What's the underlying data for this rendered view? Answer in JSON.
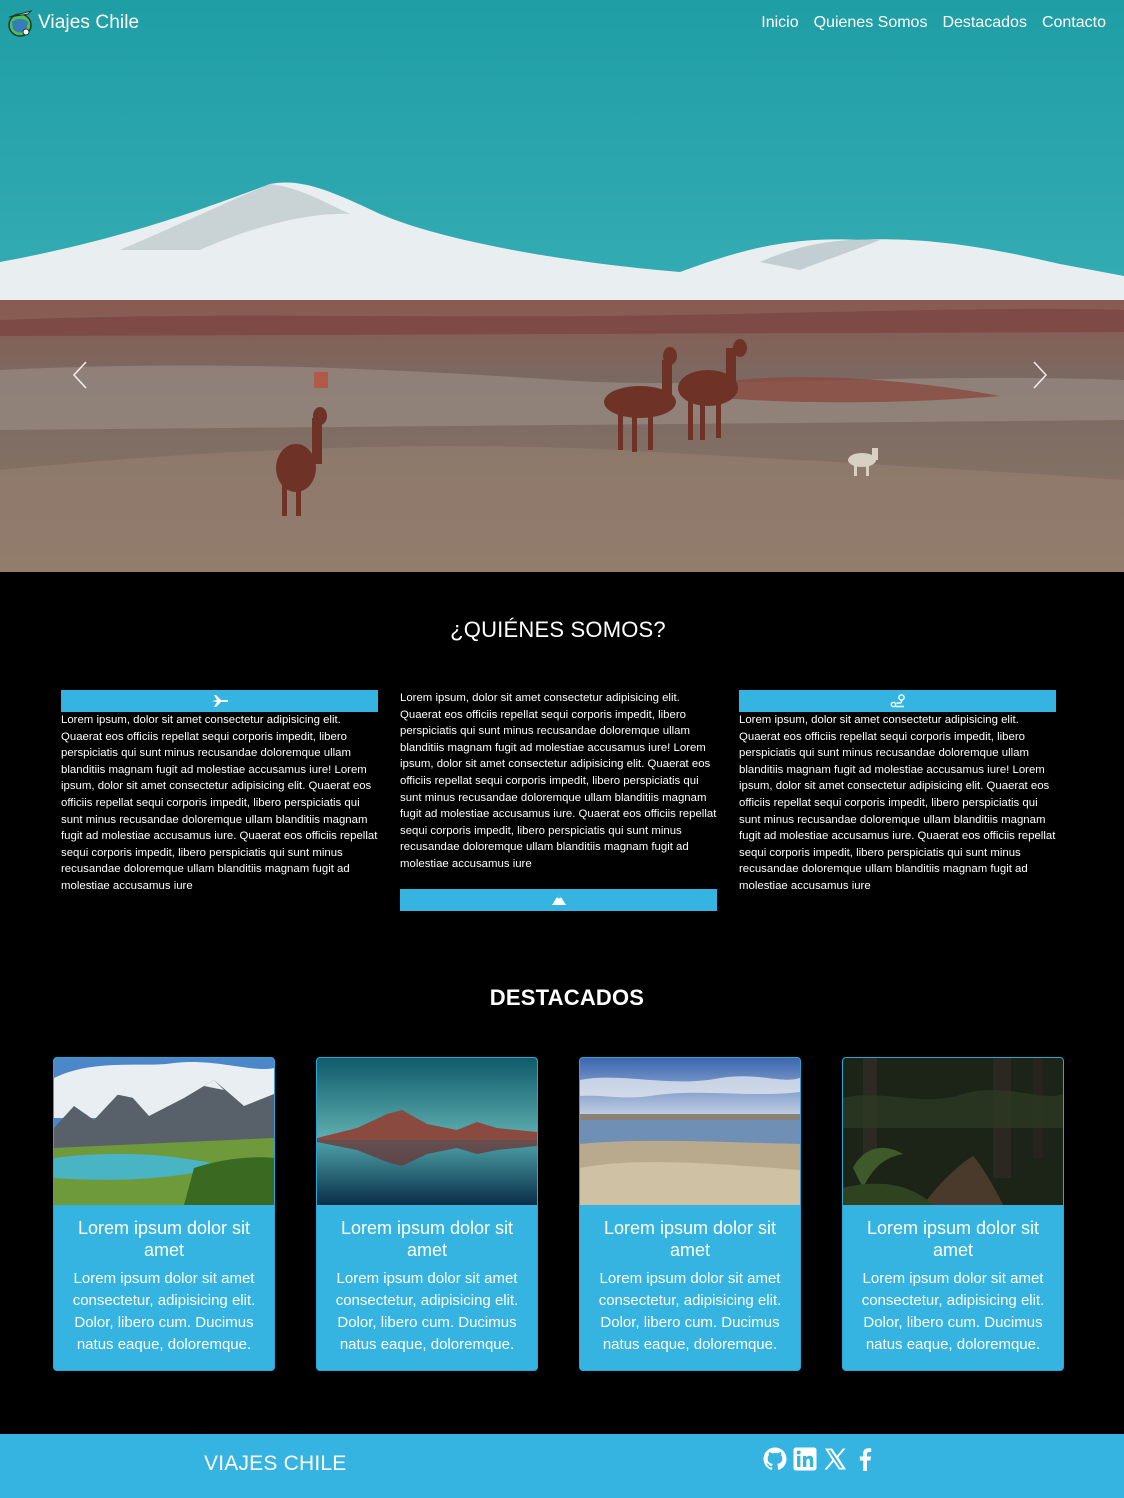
{
  "brand": {
    "name": "Viajes Chile",
    "logo": "travel-globe-icon"
  },
  "nav": {
    "items": [
      "Inicio",
      "Quienes Somos",
      "Destacados",
      "Contacto"
    ]
  },
  "carousel": {
    "prev_icon": "chevron-left-icon",
    "next_icon": "chevron-right-icon"
  },
  "about": {
    "title": "¿QUIÉNES SOMOS?",
    "columns": [
      {
        "icon": "plane-icon",
        "text": "Lorem ipsum, dolor sit amet consectetur adipisicing elit. Quaerat eos officiis repellat sequi corporis impedit, libero perspiciatis qui sunt minus recusandae doloremque ullam blanditiis magnam fugit ad molestiae accusamus iure! Lorem ipsum, dolor sit amet consectetur adipisicing elit. Quaerat eos officiis repellat sequi corporis impedit, libero perspiciatis qui sunt minus recusandae doloremque ullam blanditiis magnam fugit ad molestiae accusamus iure. Quaerat eos officiis repellat sequi corporis impedit, libero perspiciatis qui sunt minus recusandae doloremque ullam blanditiis magnam fugit ad molestiae accusamus iure"
      },
      {
        "icon": "mountain-icon",
        "text": "Lorem ipsum, dolor sit amet consectetur adipisicing elit. Quaerat eos officiis repellat sequi corporis impedit, libero perspiciatis qui sunt minus recusandae doloremque ullam blanditiis magnam fugit ad molestiae accusamus iure! Lorem ipsum, dolor sit amet consectetur adipisicing elit. Quaerat eos officiis repellat sequi corporis impedit, libero perspiciatis qui sunt minus recusandae doloremque ullam blanditiis magnam fugit ad molestiae accusamus iure. Quaerat eos officiis repellat sequi corporis impedit, libero perspiciatis qui sunt minus recusandae doloremque ullam blanditiis magnam fugit ad molestiae accusamus iure"
      },
      {
        "icon": "route-icon",
        "text": "Lorem ipsum, dolor sit amet consectetur adipisicing elit. Quaerat eos officiis repellat sequi corporis impedit, libero perspiciatis qui sunt minus recusandae doloremque ullam blanditiis magnam fugit ad molestiae accusamus iure! Lorem ipsum, dolor sit amet consectetur adipisicing elit. Quaerat eos officiis repellat sequi corporis impedit, libero perspiciatis qui sunt minus recusandae doloremque ullam blanditiis magnam fugit ad molestiae accusamus iure. Quaerat eos officiis repellat sequi corporis impedit, libero perspiciatis qui sunt minus recusandae doloremque ullam blanditiis magnam fugit ad molestiae accusamus iure"
      }
    ]
  },
  "featured": {
    "title": "DESTACADOS",
    "cards": [
      {
        "title": "Lorem ipsum dolor sit amet",
        "text": "Lorem ipsum dolor sit amet consectetur, adipisicing elit. Dolor, libero cum. Ducimus natus eaque, doloremque."
      },
      {
        "title": "Lorem ipsum dolor sit amet",
        "text": "Lorem ipsum dolor sit amet consectetur, adipisicing elit. Dolor, libero cum. Ducimus natus eaque, doloremque."
      },
      {
        "title": "Lorem ipsum dolor sit amet",
        "text": "Lorem ipsum dolor sit amet consectetur, adipisicing elit. Dolor, libero cum. Ducimus natus eaque, doloremque."
      },
      {
        "title": "Lorem ipsum dolor sit amet",
        "text": "Lorem ipsum dolor sit amet consectetur, adipisicing elit. Dolor, libero cum. Ducimus natus eaque, doloremque."
      }
    ]
  },
  "footer": {
    "brand": "VIAJES CHILE",
    "socials": [
      "github-icon",
      "linkedin-icon",
      "x-icon",
      "facebook-icon"
    ]
  },
  "colors": {
    "accent": "#35b4e2",
    "background": "#000000",
    "text": "#ffffff"
  }
}
